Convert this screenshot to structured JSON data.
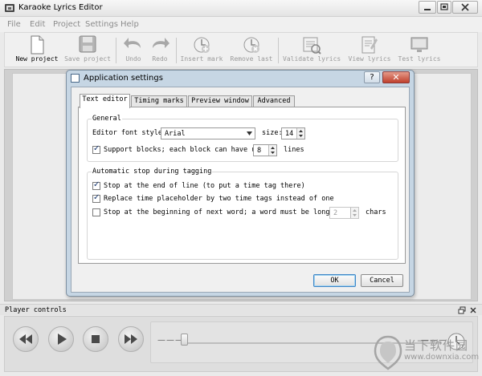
{
  "window": {
    "title": "Karaoke Lyrics Editor"
  },
  "menu": [
    "File",
    "Edit",
    "Project",
    "Settings",
    "Help"
  ],
  "toolbar": {
    "new_project": "New project",
    "save_project": "Save project",
    "undo": "Undo",
    "redo": "Redo",
    "insert_mark": "Insert mark",
    "remove_last": "Remove last",
    "validate_lyrics": "Validate lyrics",
    "view_lyrics": "View lyrics",
    "test_lyrics": "Test lyrics"
  },
  "player": {
    "title": "Player controls",
    "time_left": "———",
    "time_right": "———"
  },
  "dialog": {
    "title": "Application settings",
    "help": "?",
    "close": "✕",
    "tabs": [
      "Text editor",
      "Timing marks",
      "Preview window",
      "Advanced"
    ],
    "active_tab": "Text editor",
    "general": {
      "label": "General",
      "font_style_label": "Editor font style:",
      "font_style_value": "Arial",
      "size_label": "size:",
      "size_value": "14",
      "support_blocks_label": "Support blocks; each block can have up to",
      "support_blocks_checked": true,
      "block_lines_value": "8",
      "lines_label": "lines"
    },
    "auto_stop": {
      "label": "Automatic stop during tagging",
      "opt1": "Stop at the end of line (to put a time tag there)",
      "opt1_checked": true,
      "opt2": "Replace time placeholder by two time tags instead of one",
      "opt2_checked": true,
      "opt3": "Stop at the beginning of next word; a word must be longer than",
      "opt3_checked": false,
      "chars_value": "2",
      "chars_label": "chars"
    },
    "ok": "OK",
    "cancel": "Cancel"
  },
  "watermark": {
    "text": "当下软件园",
    "url": "www.downxia.com"
  }
}
